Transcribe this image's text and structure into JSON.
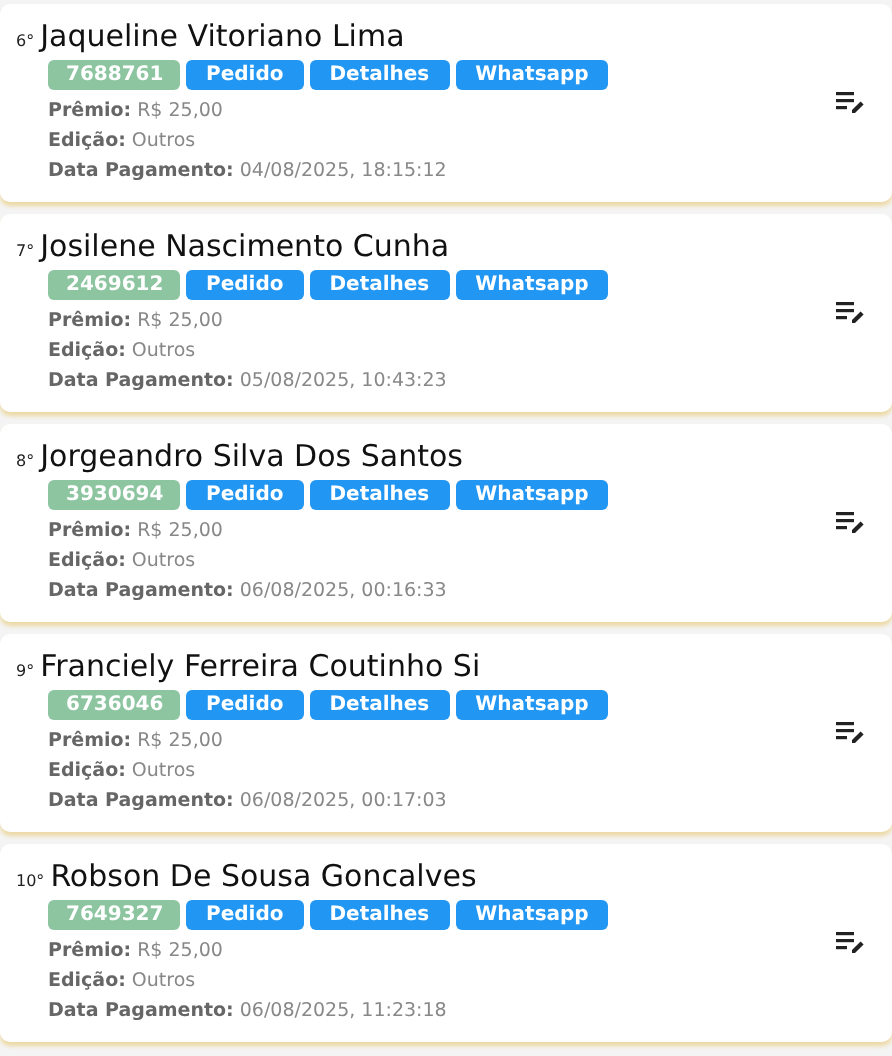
{
  "entries": [
    {
      "position": "6°",
      "name": "Jaqueline Vitoriano Lima",
      "code": "7688761",
      "buttons": [
        "Pedido",
        "Detalhes",
        "Whatsapp"
      ],
      "fields": [
        {
          "label": "Prêmio:",
          "value": "R$ 25,00"
        },
        {
          "label": "Edição:",
          "value": "Outros"
        },
        {
          "label": "Data Pagamento:",
          "value": "04/08/2025, 18:15:12"
        }
      ]
    },
    {
      "position": "7°",
      "name": "Josilene Nascimento Cunha",
      "code": "2469612",
      "buttons": [
        "Pedido",
        "Detalhes",
        "Whatsapp"
      ],
      "fields": [
        {
          "label": "Prêmio:",
          "value": "R$ 25,00"
        },
        {
          "label": "Edição:",
          "value": "Outros"
        },
        {
          "label": "Data Pagamento:",
          "value": "05/08/2025, 10:43:23"
        }
      ]
    },
    {
      "position": "8°",
      "name": "Jorgeandro Silva Dos Santos",
      "code": "3930694",
      "buttons": [
        "Pedido",
        "Detalhes",
        "Whatsapp"
      ],
      "fields": [
        {
          "label": "Prêmio:",
          "value": "R$ 25,00"
        },
        {
          "label": "Edição:",
          "value": "Outros"
        },
        {
          "label": "Data Pagamento:",
          "value": "06/08/2025, 00:16:33"
        }
      ]
    },
    {
      "position": "9°",
      "name": "Franciely Ferreira Coutinho Si",
      "code": "6736046",
      "buttons": [
        "Pedido",
        "Detalhes",
        "Whatsapp"
      ],
      "fields": [
        {
          "label": "Prêmio:",
          "value": "R$ 25,00"
        },
        {
          "label": "Edição:",
          "value": "Outros"
        },
        {
          "label": "Data Pagamento:",
          "value": "06/08/2025, 00:17:03"
        }
      ]
    },
    {
      "position": "10°",
      "name": "Robson De Sousa Goncalves",
      "code": "7649327",
      "buttons": [
        "Pedido",
        "Detalhes",
        "Whatsapp"
      ],
      "fields": [
        {
          "label": "Prêmio:",
          "value": "R$ 25,00"
        },
        {
          "label": "Edição:",
          "value": "Outros"
        },
        {
          "label": "Data Pagamento:",
          "value": "06/08/2025, 11:23:18"
        }
      ]
    }
  ]
}
